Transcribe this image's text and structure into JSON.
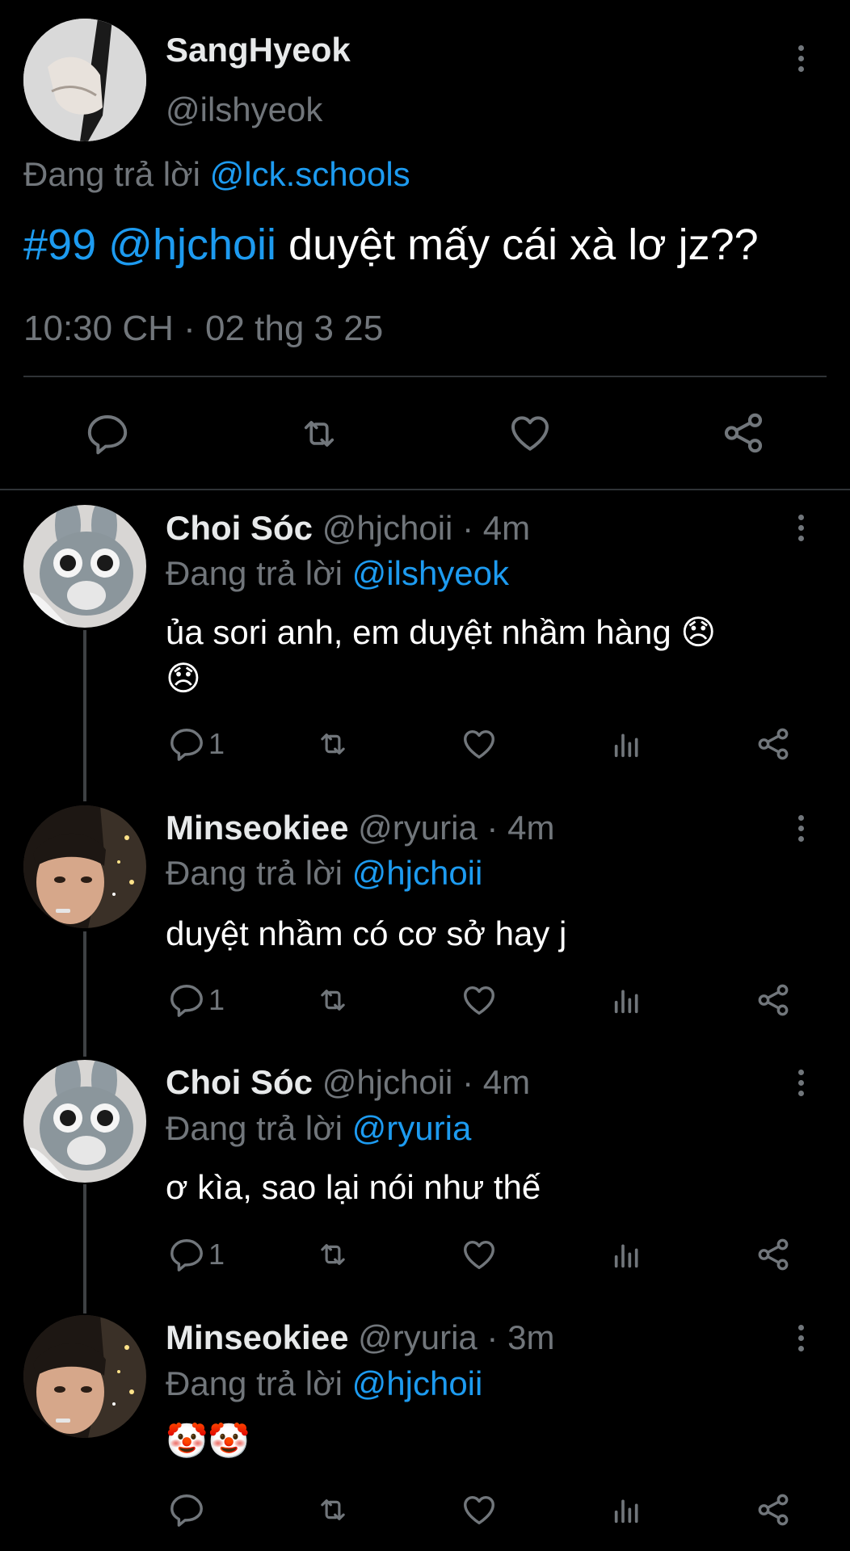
{
  "main_tweet": {
    "display_name": "SangHyeok",
    "handle": "@ilshyeok",
    "reply_prefix": "Đang trả lời",
    "reply_to": "@lck.schools",
    "hashtag": "#99",
    "mention": "@hjchoii",
    "text": " duyệt mấy cái xà lơ jz??",
    "timestamp": "10:30 CH · 02 thg 3 25"
  },
  "replies": [
    {
      "display_name": "Choi Sóc",
      "handle": "@hjchoii",
      "time": " · 4m",
      "reply_prefix": "Đang trả lời",
      "reply_to": "@ilshyeok",
      "text_line1": "ủa sori anh, em duyệt nhầm hàng 😞",
      "text_line2": "😞",
      "reply_count": "1"
    },
    {
      "display_name": "Minseokiee",
      "handle": "@ryuria",
      "time": " · 4m",
      "reply_prefix": "Đang trả lời",
      "reply_to": "@hjchoii",
      "text_line1": "duyệt nhầm có cơ sở hay j",
      "reply_count": "1"
    },
    {
      "display_name": "Choi Sóc",
      "handle": "@hjchoii",
      "time": " · 4m",
      "reply_prefix": "Đang trả lời",
      "reply_to": "@ryuria",
      "text_line1": "ơ kìa, sao lại nói như thế",
      "reply_count": "1"
    },
    {
      "display_name": "Minseokiee",
      "handle": "@ryuria",
      "time": " · 3m",
      "reply_prefix": "Đang trả lời",
      "reply_to": "@hjchoii",
      "text_line1": "🤡🤡",
      "reply_count": ""
    }
  ],
  "colors": {
    "background": "#000000",
    "text": "#e7e9ea",
    "muted": "#71767b",
    "link": "#1d9bf0",
    "divider": "#2f3336"
  },
  "icons": [
    "more-icon",
    "reply-icon",
    "retweet-icon",
    "like-icon",
    "share-icon",
    "views-icon"
  ]
}
